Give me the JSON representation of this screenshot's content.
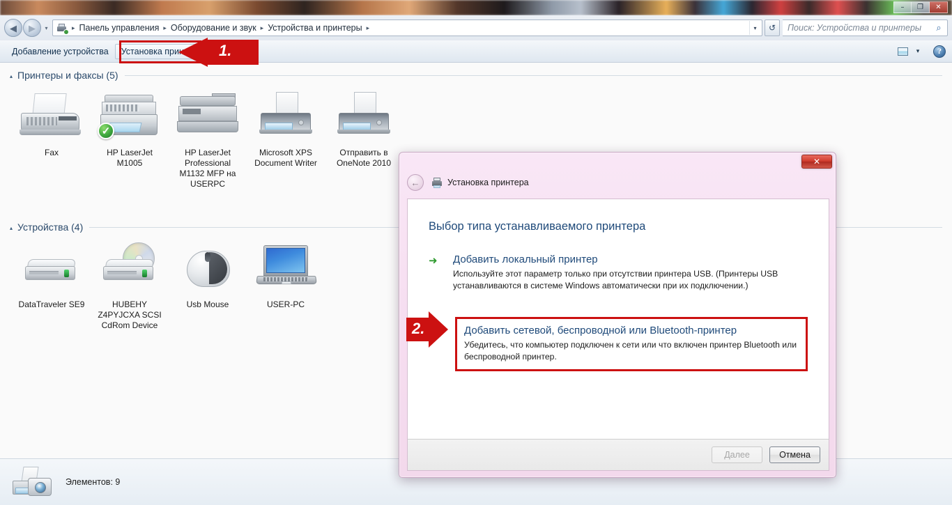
{
  "window": {
    "controls": [
      {
        "name": "minimize",
        "glyph": "–"
      },
      {
        "name": "restore",
        "glyph": "❐"
      },
      {
        "name": "close",
        "glyph": "✕"
      }
    ]
  },
  "addressbar": {
    "back_glyph": "◀",
    "forward_glyph": "▶",
    "history_glyph": "▾",
    "breadcrumbs": [
      "Панель управления",
      "Оборудование и звук",
      "Устройства и принтеры"
    ],
    "separator": "▸",
    "dropdown_glyph": "▾",
    "refresh_glyph": "↺",
    "search_placeholder": "Поиск: Устройства и принтеры",
    "search_value": "",
    "search_icon": "⌕"
  },
  "toolbar": {
    "add_device_label": "Добавление устройства",
    "add_printer_label": "Установка принтера",
    "view_caret": "▾",
    "help_label": "?"
  },
  "groups": [
    {
      "id": "printers",
      "title": "Принтеры и факсы (5)",
      "triangle": "▴",
      "items": [
        {
          "label": "Fax",
          "art": "fax",
          "default": false
        },
        {
          "label": "HP LaserJet M1005",
          "art": "mfp",
          "default": true,
          "check_glyph": "✓"
        },
        {
          "label": "HP LaserJet Professional M1132 MFP на USERPC",
          "art": "lj",
          "default": false
        },
        {
          "label": "Microsoft XPS Document Writer",
          "art": "vprint",
          "default": false
        },
        {
          "label": "Отправить в OneNote 2010",
          "art": "vprint",
          "default": false
        }
      ]
    },
    {
      "id": "devices",
      "title": "Устройства (4)",
      "triangle": "▴",
      "items": [
        {
          "label": "DataTraveler SE9",
          "art": "hdd"
        },
        {
          "label": "HUBEHY Z4PYJCXA SCSI CdRom Device",
          "art": "cd"
        },
        {
          "label": "Usb Mouse",
          "art": "mouse"
        },
        {
          "label": "USER-PC",
          "art": "laptop"
        }
      ]
    }
  ],
  "statusbar": {
    "items_label": "Элементов: 9"
  },
  "callouts": [
    {
      "id": "one",
      "number": "1."
    },
    {
      "id": "two",
      "number": "2."
    }
  ],
  "dialog": {
    "close_glyph": "✕",
    "back_glyph": "←",
    "title": "Установка принтера",
    "heading": "Выбор типа устанавливаемого принтера",
    "options": [
      {
        "arrow": "➜",
        "title": "Добавить локальный принтер",
        "desc": "Используйте этот параметр только при отсутствии принтера USB. (Принтеры USB устанавливаются в системе Windows автоматически при их подключении.)",
        "highlighted": false
      },
      {
        "arrow": "",
        "title": "Добавить сетевой, беспроводной или Bluetooth-принтер",
        "desc": "Убедитесь, что компьютер подключен к сети или что включен принтер Bluetooth или беспроводной принтер.",
        "highlighted": true
      }
    ],
    "next_label": "Далее",
    "cancel_label": "Отмена"
  },
  "colors": {
    "accent_red": "#cc1111",
    "link_blue": "#1f4a7a",
    "group_header": "#2b4a6b",
    "dialog_pink": "#f6ddf0",
    "default_check_green": "#3fa83f"
  }
}
